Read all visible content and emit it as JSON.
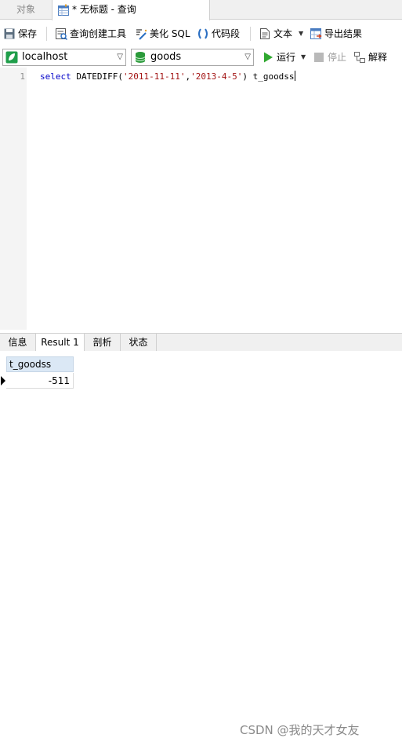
{
  "tabs": {
    "objects_label": "对象",
    "query_label": "* 无标题 - 查询"
  },
  "toolbar": {
    "save": "保存",
    "query_builder": "查询创建工具",
    "beautify_sql": "美化 SQL",
    "code_snippet": "代码段",
    "text": "文本",
    "export_results": "导出结果"
  },
  "connection": {
    "server": "localhost",
    "database": "goods",
    "run": "运行",
    "stop": "停止",
    "explain": "解释"
  },
  "editor": {
    "line_number": "1",
    "kw_select": "select",
    "sp1": " ",
    "func": "DATEDIFF(",
    "str1": "'2011-11-11'",
    "comma": ",",
    "str2": "'2013-4-5'",
    "close": ") t_goodss"
  },
  "results": {
    "tabs": [
      "信息",
      "Result 1",
      "剖析",
      "状态"
    ],
    "active_tab": "Result 1",
    "column": "t_goodss",
    "rows": [
      [
        "-511"
      ]
    ]
  },
  "watermark": "CSDN @我的天才女友",
  "colors": {
    "keyword": "#0000c8",
    "string": "#a31515",
    "run_green": "#2fa82f",
    "header_blue": "#dbe8f5"
  }
}
